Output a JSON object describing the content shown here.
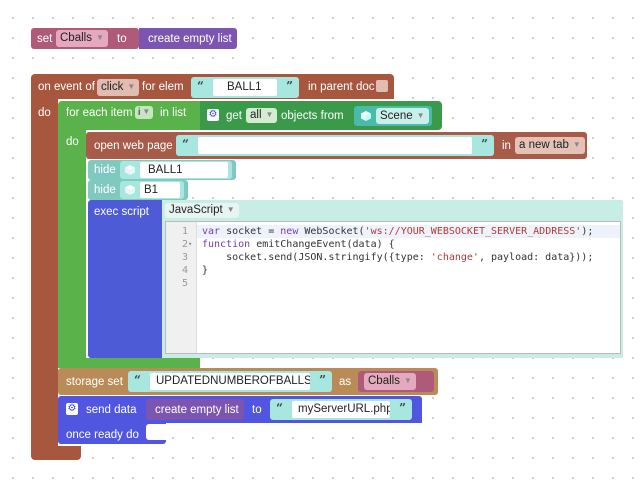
{
  "colors": {
    "variable": "#b05a7a",
    "list": "#7c55b0",
    "event": "#a8573f",
    "loop": "#5ab24a",
    "text_block": "#a8e6e0",
    "object_block": "#49bba8",
    "action": "#a75c4a",
    "hide_block": "#7fc9c0",
    "script": "#4d5bd6",
    "storage": "#b98c57",
    "network": "#5156e0"
  },
  "set_block": {
    "set_label": "set",
    "var_name": "Cballs",
    "to_label": "to",
    "value_label": "create empty list"
  },
  "event_block": {
    "on_event_label": "on event of",
    "event_type": "click",
    "for_elem_label": "for elem",
    "elem_value": "BALL1",
    "in_parent_label": "in parent doc",
    "do_label": "do"
  },
  "loop_block": {
    "for_each_label": "for each item",
    "item_var": "i",
    "in_list_label": "in list",
    "get_label": "get",
    "get_scope": "all",
    "objects_from_label": "objects from",
    "scene_value": "Scene",
    "do_label": "do"
  },
  "open_page_block": {
    "label": "open web page",
    "url": "",
    "in_label": "in",
    "target": "a new tab"
  },
  "hide_blocks": [
    {
      "label": "hide",
      "target": "BALL1"
    },
    {
      "label": "hide",
      "target": "B1"
    }
  ],
  "exec_block": {
    "label": "exec script",
    "language": "JavaScript",
    "line_numbers": [
      "1",
      "2",
      "3",
      "4",
      "5"
    ],
    "lines": [
      "var socket = new WebSocket('ws://YOUR_WEBSOCKET_SERVER_ADDRESS');",
      "function emitChangeEvent(data) {",
      "    socket.send(JSON.stringify({type: 'change', payload: data}));",
      "}",
      ""
    ]
  },
  "storage_block": {
    "label": "storage set",
    "key": "UPDATEDNUMBEROFBALLS",
    "as_label": "as",
    "value": "Cballs"
  },
  "send_block": {
    "label": "send data",
    "data_label": "create empty list",
    "to_label": "to",
    "url": "myServerURL.php",
    "once_ready_label": "once ready do"
  }
}
